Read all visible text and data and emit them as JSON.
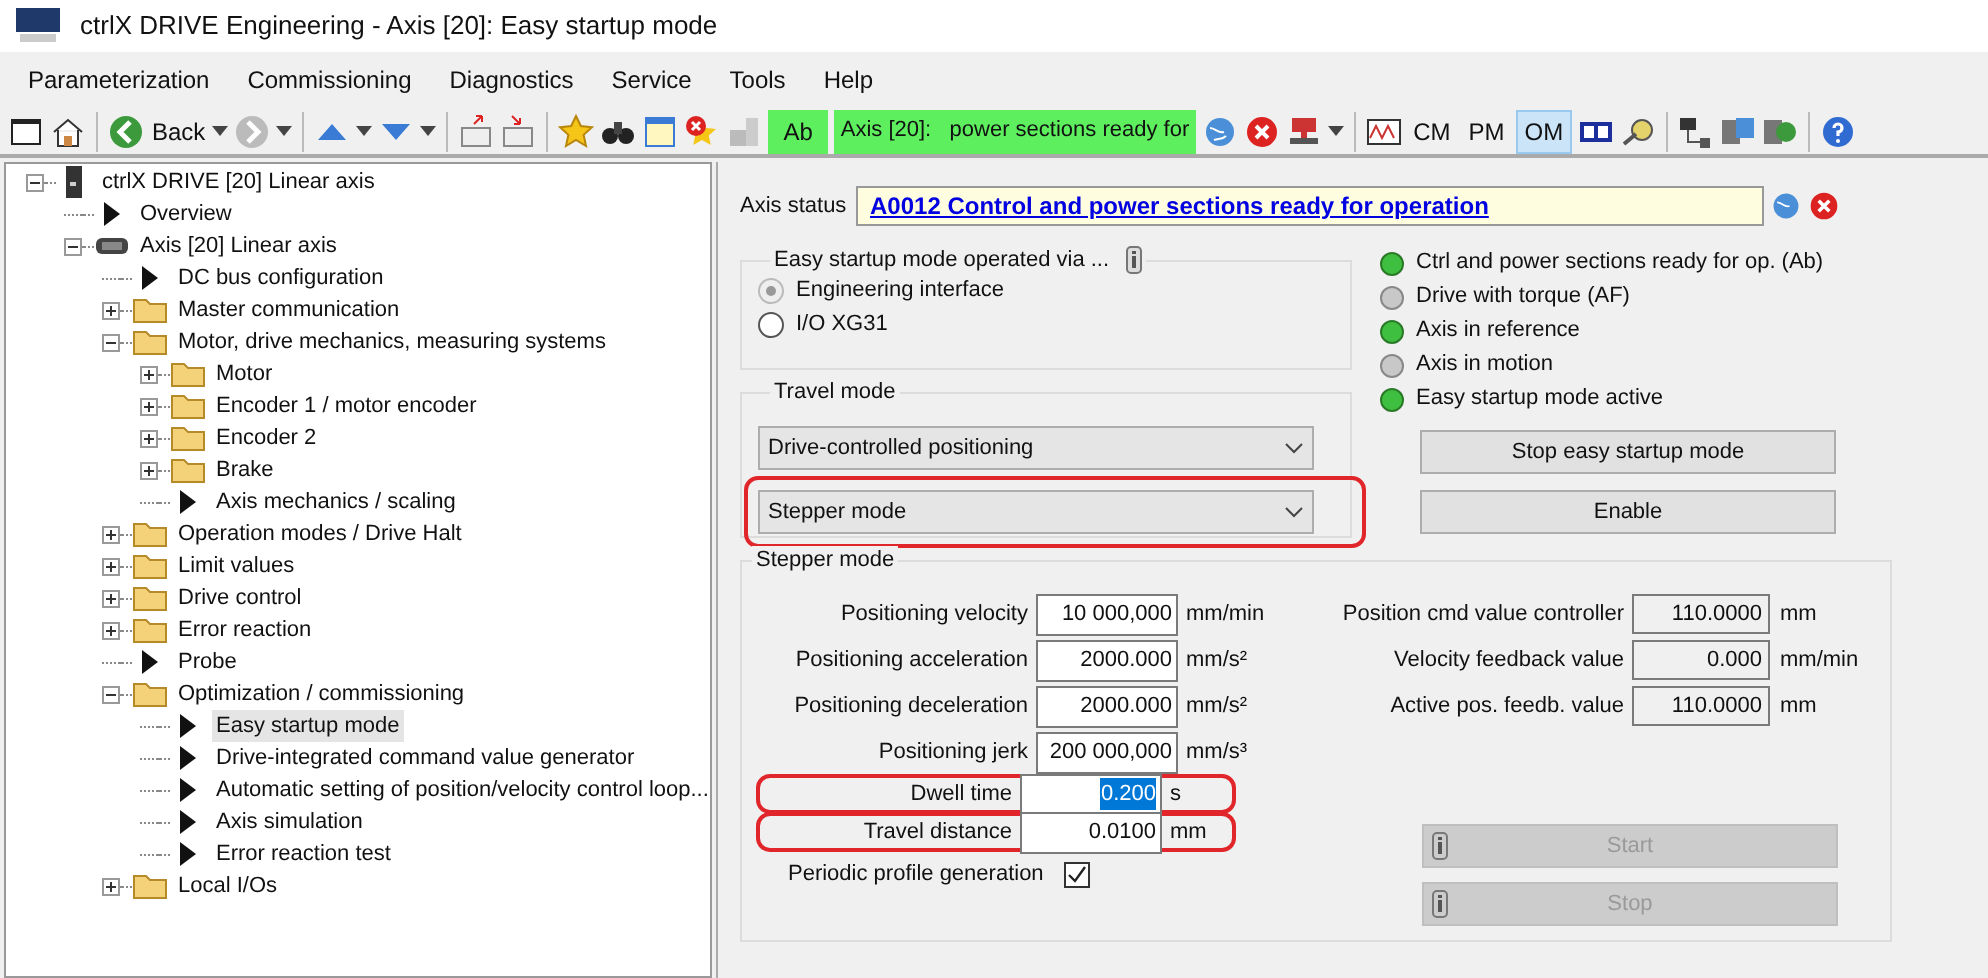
{
  "window": {
    "title": "ctrlX DRIVE Engineering - Axis [20]: Easy startup mode"
  },
  "menu": [
    "Parameterization",
    "Commissioning",
    "Diagnostics",
    "Service",
    "Tools",
    "Help"
  ],
  "toolbar": {
    "back_label": "Back",
    "status_code": "Ab",
    "status_text": "Axis [20]:   power sections ready for",
    "modes": [
      {
        "label": "CM",
        "selected": false
      },
      {
        "label": "PM",
        "selected": false
      },
      {
        "label": "OM",
        "selected": true
      }
    ]
  },
  "tree": [
    {
      "label": "ctrlX DRIVE [20] Linear axis",
      "kind": "device",
      "expanded": true,
      "selected": false,
      "children": [
        {
          "label": "Overview",
          "kind": "page",
          "selected": false
        },
        {
          "label": "Axis [20] Linear axis",
          "kind": "axis",
          "expanded": true,
          "selected": false,
          "children": [
            {
              "label": "DC bus configuration",
              "kind": "page",
              "selected": false
            },
            {
              "label": "Master communication",
              "kind": "folder",
              "expanded": false,
              "selected": false
            },
            {
              "label": "Motor, drive mechanics, measuring systems",
              "kind": "folder",
              "expanded": true,
              "selected": false,
              "children": [
                {
                  "label": "Motor",
                  "kind": "folder",
                  "expanded": false,
                  "selected": false
                },
                {
                  "label": "Encoder 1 / motor encoder",
                  "kind": "folder",
                  "expanded": false,
                  "selected": false
                },
                {
                  "label": "Encoder 2",
                  "kind": "folder",
                  "expanded": false,
                  "selected": false
                },
                {
                  "label": "Brake",
                  "kind": "folder",
                  "expanded": false,
                  "selected": false
                },
                {
                  "label": "Axis mechanics / scaling",
                  "kind": "page",
                  "selected": false
                }
              ]
            },
            {
              "label": "Operation modes / Drive Halt",
              "kind": "folder",
              "expanded": false,
              "selected": false
            },
            {
              "label": "Limit values",
              "kind": "folder",
              "expanded": false,
              "selected": false
            },
            {
              "label": "Drive control",
              "kind": "folder",
              "expanded": false,
              "selected": false
            },
            {
              "label": "Error reaction",
              "kind": "folder",
              "expanded": false,
              "selected": false
            },
            {
              "label": "Probe",
              "kind": "page",
              "selected": false
            },
            {
              "label": "Optimization / commissioning",
              "kind": "folder",
              "expanded": true,
              "selected": false,
              "children": [
                {
                  "label": "Easy startup mode",
                  "kind": "page",
                  "selected": true
                },
                {
                  "label": "Drive-integrated command value generator",
                  "kind": "page",
                  "selected": false
                },
                {
                  "label": "Automatic setting of position/velocity control loop...",
                  "kind": "page",
                  "selected": false
                },
                {
                  "label": "Axis simulation",
                  "kind": "page",
                  "selected": false
                },
                {
                  "label": "Error reaction test",
                  "kind": "page",
                  "selected": false
                }
              ]
            },
            {
              "label": "Local I/Os",
              "kind": "folder",
              "expanded": false,
              "selected": false
            }
          ]
        }
      ]
    }
  ],
  "axis_status": {
    "label": "Axis status",
    "value": "A0012 Control and power sections ready for operation"
  },
  "operated_via": {
    "title": "Easy startup mode operated via ...",
    "options": [
      {
        "label": "Engineering interface",
        "selected": true,
        "disabled": true
      },
      {
        "label": "I/O XG31",
        "selected": false,
        "disabled": false
      }
    ]
  },
  "travel_mode": {
    "title": "Travel mode",
    "selects": [
      {
        "value": "Drive-controlled positioning",
        "highlighted": false
      },
      {
        "value": "Stepper mode",
        "highlighted": true
      }
    ]
  },
  "indicators": [
    {
      "label": "Ctrl and power sections ready for op. (Ab)",
      "on": true
    },
    {
      "label": "Drive with torque (AF)",
      "on": false
    },
    {
      "label": "Axis in reference",
      "on": true
    },
    {
      "label": "Axis in motion",
      "on": false
    },
    {
      "label": "Easy startup mode active",
      "on": true
    }
  ],
  "actions": [
    {
      "label": "Stop easy startup mode"
    },
    {
      "label": "Enable"
    }
  ],
  "stepper": {
    "title": "Stepper mode",
    "params": [
      {
        "label": "Positioning velocity",
        "value": "10 000,000",
        "unit": "mm/min",
        "highlighted": false,
        "text_selected": false
      },
      {
        "label": "Positioning acceleration",
        "value": "2000.000",
        "unit": "mm/s²",
        "highlighted": false,
        "text_selected": false
      },
      {
        "label": "Positioning deceleration",
        "value": "2000.000",
        "unit": "mm/s²",
        "highlighted": false,
        "text_selected": false
      },
      {
        "label": "Positioning jerk",
        "value": "200 000,000",
        "unit": "mm/s³",
        "highlighted": false,
        "text_selected": false
      },
      {
        "label": "Dwell time",
        "value": "0.200",
        "unit": "s",
        "highlighted": true,
        "text_selected": true
      },
      {
        "label": "Travel distance",
        "value": "0.0100",
        "unit": "mm",
        "highlighted": true,
        "text_selected": false
      }
    ],
    "periodic": {
      "label": "Periodic profile generation",
      "checked": true
    },
    "readouts": [
      {
        "label": "Position cmd value controller",
        "value": "110.0000",
        "unit": "mm"
      },
      {
        "label": "Velocity feedback value",
        "value": "0.000",
        "unit": "mm/min"
      },
      {
        "label": "Active pos. feedb. value",
        "value": "110.0000",
        "unit": "mm"
      }
    ],
    "buttons": [
      {
        "label": "Start",
        "disabled": true
      },
      {
        "label": "Stop",
        "disabled": true
      }
    ]
  }
}
